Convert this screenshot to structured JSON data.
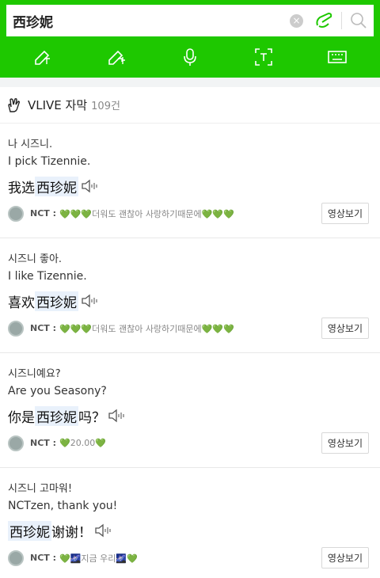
{
  "search": {
    "query": "西珍妮",
    "clear_icon": "×"
  },
  "tools": [
    {
      "name": "handwriting-hanzi-icon"
    },
    {
      "name": "handwriting-hangul-icon"
    },
    {
      "name": "microphone-icon"
    },
    {
      "name": "text-scan-icon"
    },
    {
      "name": "keyboard-icon"
    }
  ],
  "section": {
    "title": "VLIVE 자막",
    "count": "109건"
  },
  "items": [
    {
      "ko": "나 시즈니.",
      "en": "I pick Tizennie.",
      "zh_before": "我选",
      "zh_hl": "西珍妮",
      "zh_after": "",
      "source": "NCT :",
      "source_text": "💚💚💚더워도 괜찮아 사랑하기때문에💚💚💚",
      "watch": "영상보기"
    },
    {
      "ko": "시즈니 좋아.",
      "en": "I like Tizennie.",
      "zh_before": "喜欢",
      "zh_hl": "西珍妮",
      "zh_after": "",
      "source": "NCT :",
      "source_text": "💚💚💚더워도 괜찮아 사랑하기때문에💚💚💚",
      "watch": "영상보기"
    },
    {
      "ko": "시즈니예요?",
      "en": "Are you Seasony?",
      "zh_before": "你是",
      "zh_hl": "西珍妮",
      "zh_after": "吗？",
      "source": "NCT :",
      "source_text": "💚20.00💚",
      "watch": "영상보기"
    },
    {
      "ko": "시즈니 고마워!",
      "en": "NCTzen, thank you!",
      "zh_before": "",
      "zh_hl": "西珍妮",
      "zh_after": " 谢谢！",
      "source": "NCT :",
      "source_text": "💚🌌지금 우리🌌💚",
      "watch": "영상보기"
    }
  ]
}
